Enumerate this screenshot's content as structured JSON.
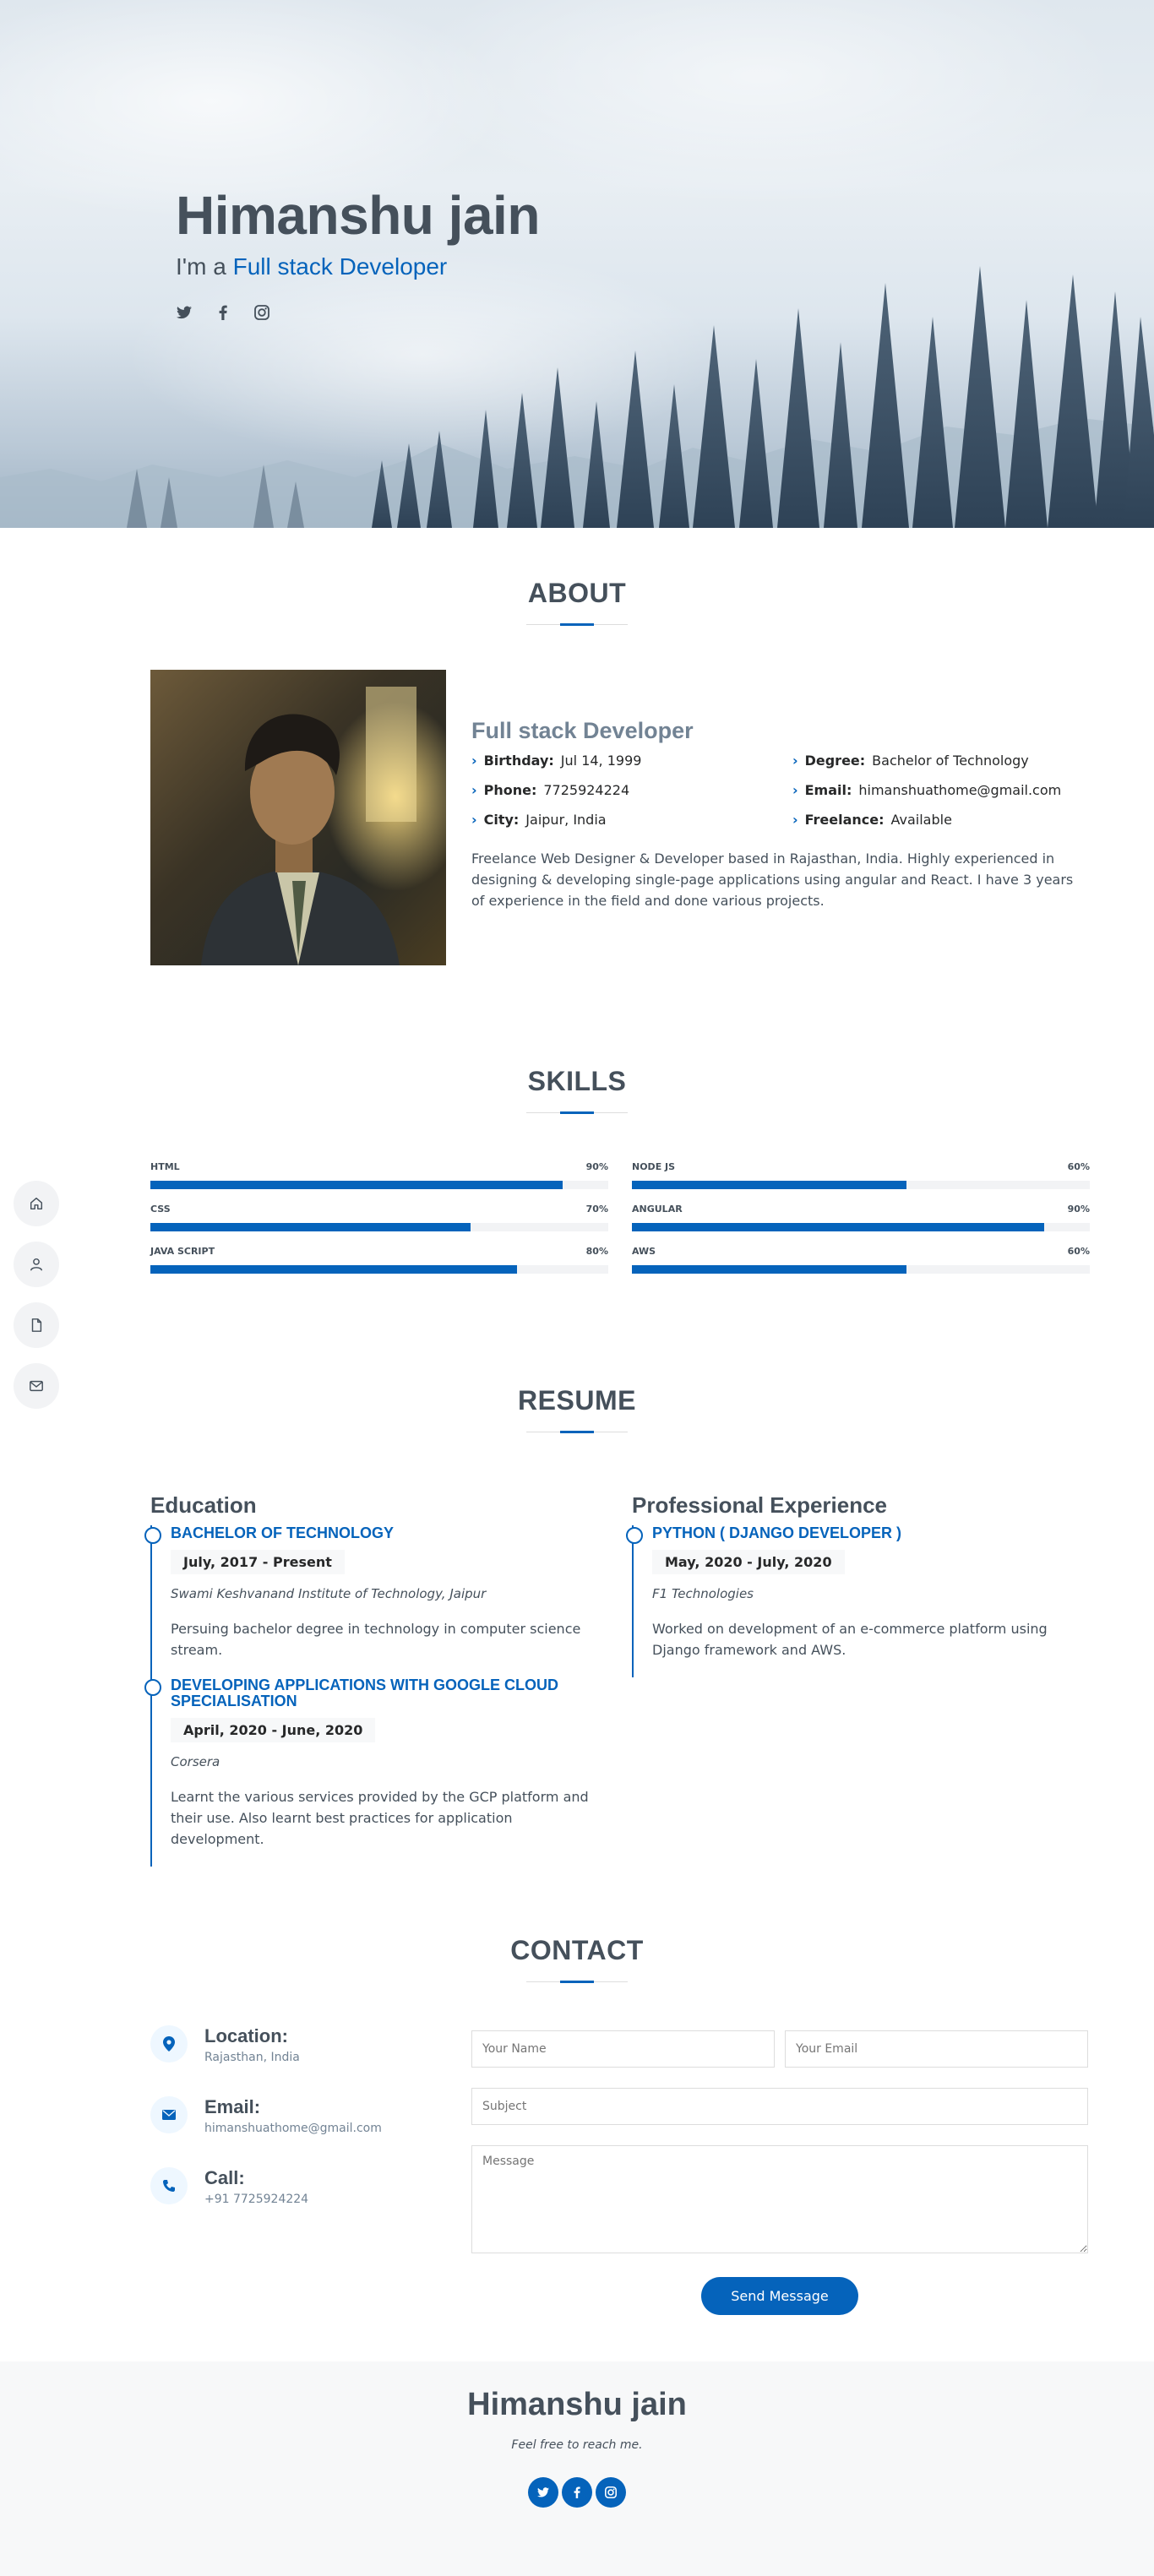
{
  "hero": {
    "name": "Himanshu jain",
    "tagline_prefix": "I'm a",
    "tagline_typed": "Full stack Developer",
    "social": [
      "twitter-icon",
      "facebook-icon",
      "instagram-icon"
    ]
  },
  "sidenav": [
    "home-icon",
    "user-icon",
    "file-icon",
    "envelope-icon"
  ],
  "about": {
    "title": "ABOUT",
    "role": "Full stack Developer",
    "facts": [
      {
        "label": "Birthday:",
        "value": "Jul 14, 1999"
      },
      {
        "label": "Degree:",
        "value": "Bachelor of Technology"
      },
      {
        "label": "Phone:",
        "value": "7725924224"
      },
      {
        "label": "Email:",
        "value": "himanshuathome@gmail.com"
      },
      {
        "label": "City:",
        "value": "Jaipur, India"
      },
      {
        "label": "Freelance:",
        "value": "Available"
      }
    ],
    "description": "Freelance Web Designer & Developer based in Rajasthan, India. Highly experienced in designing & developing single-page applications using angular and React. I have 3 years of experience in the field and done various projects."
  },
  "skills": {
    "title": "SKILLS",
    "items": [
      {
        "name": "HTML",
        "value": "90%",
        "percent": 90
      },
      {
        "name": "NODE JS",
        "value": "60%",
        "percent": 60
      },
      {
        "name": "CSS",
        "value": "70%",
        "percent": 70
      },
      {
        "name": "ANGULAR",
        "value": "90%",
        "percent": 90
      },
      {
        "name": "JAVA SCRIPT",
        "value": "80%",
        "percent": 80
      },
      {
        "name": "AWS",
        "value": "60%",
        "percent": 60
      }
    ]
  },
  "resume": {
    "title": "RESUME",
    "education": {
      "heading": "Education",
      "items": [
        {
          "title": "BACHELOR OF TECHNOLOGY",
          "date": "July, 2017 - Present",
          "institution": "Swami Keshvanand Institute of Technology, Jaipur",
          "desc": "Persuing bachelor degree in technology in computer science stream."
        },
        {
          "title": "DEVELOPING APPLICATIONS WITH GOOGLE CLOUD SPECIALISATION",
          "date": "April, 2020 - June, 2020",
          "institution": "Corsera",
          "desc": "Learnt the various services provided by the GCP platform and their use. Also learnt best practices for application development."
        }
      ]
    },
    "experience": {
      "heading": "Professional Experience",
      "items": [
        {
          "title": "PYTHON ( DJANGO DEVELOPER )",
          "date": "May, 2020 - July, 2020",
          "institution": "F1 Technologies",
          "desc": "Worked on development of an e-commerce platform using Django framework and AWS."
        }
      ]
    }
  },
  "contact": {
    "title": "CONTACT",
    "location": {
      "label": "Location:",
      "value": "Rajasthan, India"
    },
    "email": {
      "label": "Email:",
      "value": "himanshuathome@gmail.com"
    },
    "call": {
      "label": "Call:",
      "value": "+91 7725924224"
    },
    "form": {
      "name_placeholder": "Your Name",
      "email_placeholder": "Your Email",
      "subject_placeholder": "Subject",
      "message_placeholder": "Message",
      "send_label": "Send Message"
    }
  },
  "footer": {
    "name": "Himanshu jain",
    "tagline": "Feel free to reach me.",
    "social": [
      "twitter-icon",
      "facebook-icon",
      "instagram-icon"
    ]
  },
  "colors": {
    "accent": "#0563bb",
    "heading": "#45505b",
    "muted": "#728394"
  }
}
